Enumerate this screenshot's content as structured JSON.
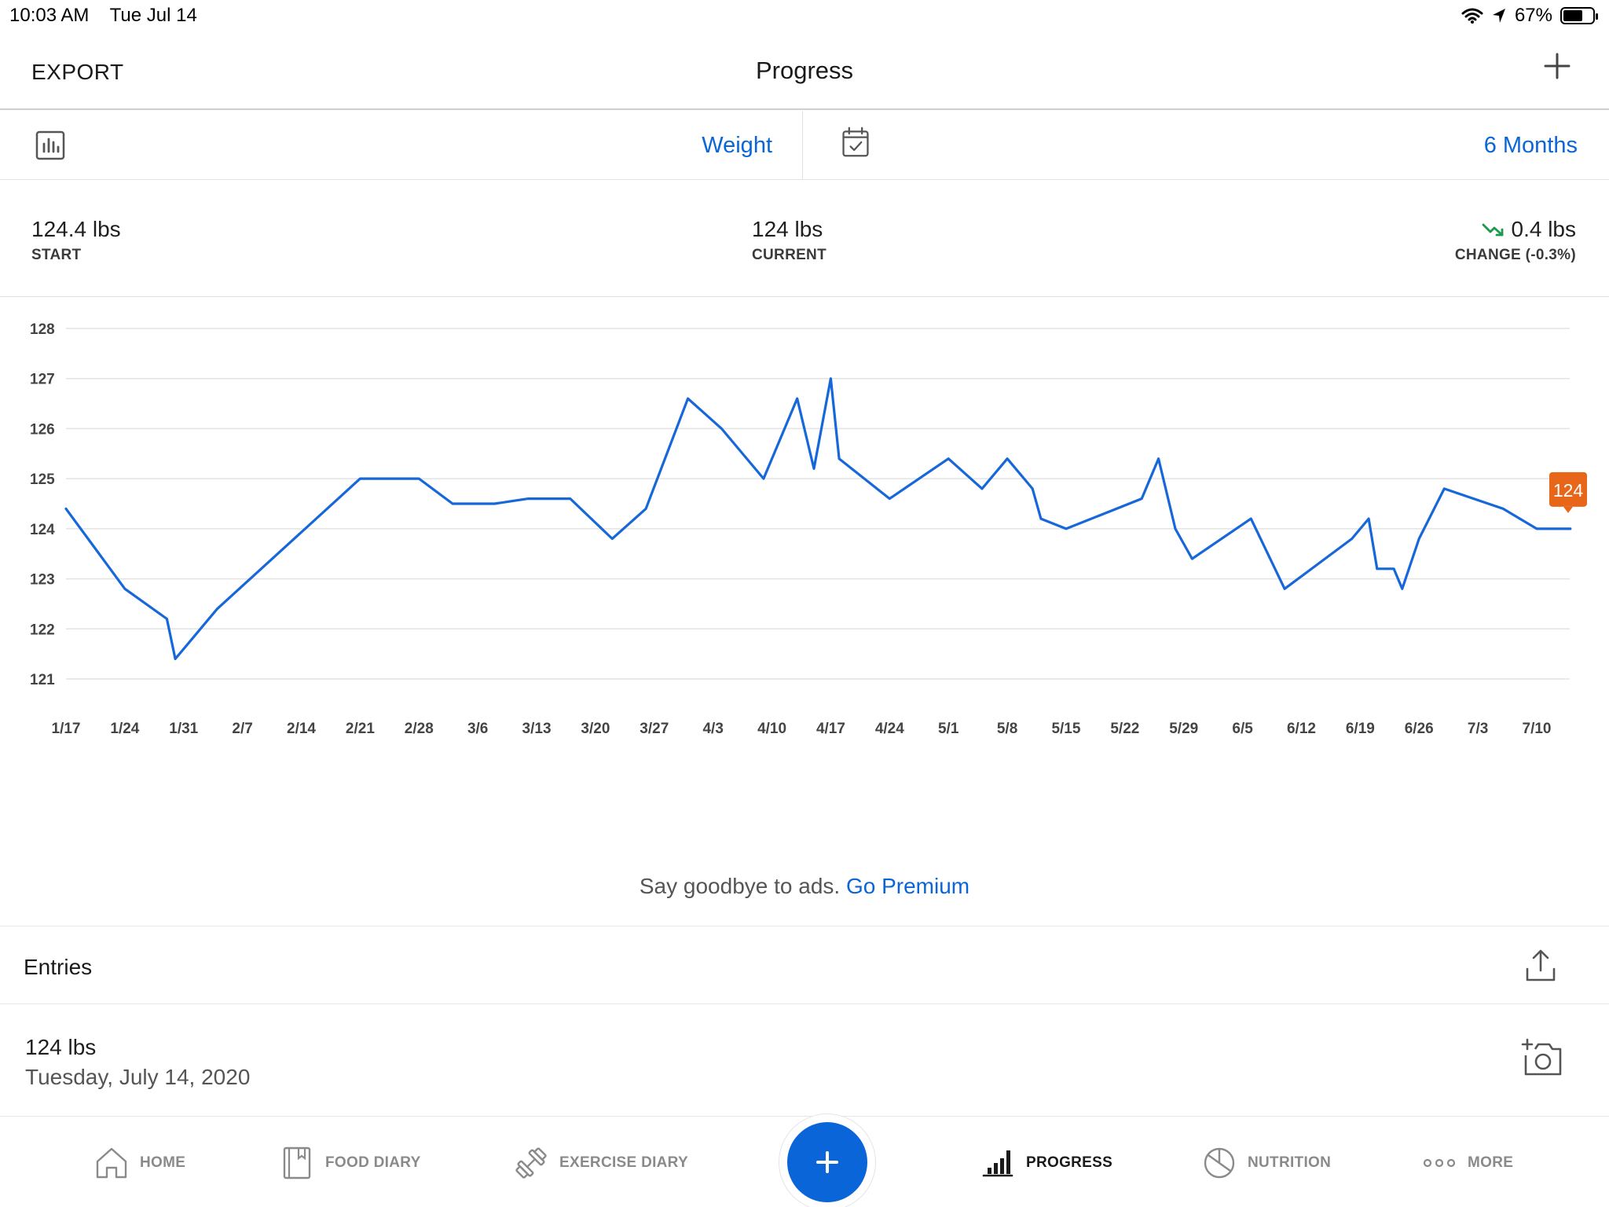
{
  "status": {
    "time": "10:03 AM",
    "date": "Tue Jul 14",
    "battery": "67%",
    "battery_level": 0.67
  },
  "nav": {
    "export_label": "EXPORT",
    "title": "Progress",
    "add_icon": "plus-icon"
  },
  "selectors": {
    "metric_icon": "bar-chart-icon",
    "metric": "Weight",
    "range_icon": "calendar-check-icon",
    "range": "6 Months"
  },
  "summary": {
    "start_value": "124.4 lbs",
    "start_label": "START",
    "current_value": "124 lbs",
    "current_label": "CURRENT",
    "change_value": "0.4 lbs",
    "change_label": "CHANGE (-0.3%)",
    "change_icon": "trend-down-icon"
  },
  "colors": {
    "accent": "#0a66d8",
    "line": "#1667d9",
    "marker": "#e8661a",
    "trend_down": "#1a9a4a"
  },
  "chart_data": {
    "type": "line",
    "ylim": [
      121,
      128
    ],
    "yticks": [
      "128",
      "127",
      "126",
      "125",
      "124",
      "123",
      "122",
      "121"
    ],
    "xticks": [
      "1/17",
      "1/24",
      "1/31",
      "2/7",
      "2/14",
      "2/21",
      "2/28",
      "3/6",
      "3/13",
      "3/20",
      "3/27",
      "4/3",
      "4/10",
      "4/17",
      "4/24",
      "5/1",
      "5/8",
      "5/15",
      "5/22",
      "5/29",
      "6/5",
      "6/12",
      "6/19",
      "6/26",
      "7/3",
      "7/10"
    ],
    "grid": true,
    "x": [
      0,
      7,
      12,
      13,
      18,
      35,
      42,
      45,
      50,
      54,
      59,
      64,
      66,
      73,
      77,
      81,
      85,
      88,
      89,
      93,
      98,
      105,
      110,
      113,
      116,
      119,
      122,
      128,
      134,
      136,
      138,
      142,
      146,
      160,
      161,
      162,
      168,
      174,
      178,
      180,
      181,
      183,
      185,
      188,
      183,
      185,
      187,
      189,
      195,
      198,
      200,
      205,
      213,
      219,
      220,
      227,
      231,
      237,
      240,
      244,
      247,
      255,
      250,
      251,
      255,
      256,
      258,
      262,
      268,
      272,
      275,
      280,
      284,
      290,
      295,
      300,
      301,
      304,
      305,
      307,
      322,
      329,
      335,
      348,
      355,
      361,
      367,
      376,
      387
    ],
    "y_note": "",
    "points": [
      {
        "x": "1/17",
        "y": 124.4
      },
      {
        "x": "1/24",
        "y": 122.8
      },
      {
        "x": "1/29",
        "y": 122.2
      },
      {
        "x": "1/30",
        "y": 121.4
      },
      {
        "x": "2/4",
        "y": 122.4
      },
      {
        "x": "2/21",
        "y": 125.0
      },
      {
        "x": "2/28",
        "y": 125.0
      },
      {
        "x": "3/3",
        "y": 124.5
      },
      {
        "x": "3/8",
        "y": 124.5
      },
      {
        "x": "3/12",
        "y": 124.6
      },
      {
        "x": "3/17",
        "y": 124.6
      },
      {
        "x": "3/22",
        "y": 123.8
      },
      {
        "x": "3/26",
        "y": 124.4
      },
      {
        "x": "3/31",
        "y": 126.6
      },
      {
        "x": "4/4",
        "y": 126.0
      },
      {
        "x": "4/9",
        "y": 125.0
      },
      {
        "x": "4/13",
        "y": 126.6
      },
      {
        "x": "4/15",
        "y": 125.2
      },
      {
        "x": "4/17",
        "y": 127.0
      },
      {
        "x": "4/18",
        "y": 125.4
      },
      {
        "x": "4/24",
        "y": 124.6
      },
      {
        "x": "5/1",
        "y": 125.4
      },
      {
        "x": "5/5",
        "y": 124.8
      },
      {
        "x": "5/8",
        "y": 125.4
      },
      {
        "x": "5/11",
        "y": 124.8
      },
      {
        "x": "5/12",
        "y": 124.2
      },
      {
        "x": "5/15",
        "y": 124.0
      },
      {
        "x": "5/24",
        "y": 124.6
      },
      {
        "x": "5/26",
        "y": 125.4
      },
      {
        "x": "5/28",
        "y": 124.0
      },
      {
        "x": "5/30",
        "y": 123.4
      },
      {
        "x": "6/6",
        "y": 124.2
      },
      {
        "x": "6/10",
        "y": 122.8
      },
      {
        "x": "6/18",
        "y": 123.8
      },
      {
        "x": "6/20",
        "y": 124.2
      },
      {
        "x": "6/21",
        "y": 123.2
      },
      {
        "x": "6/23",
        "y": 123.2
      },
      {
        "x": "6/24",
        "y": 122.8
      },
      {
        "x": "6/26",
        "y": 123.8
      },
      {
        "x": "6/29",
        "y": 124.8
      },
      {
        "x": "7/6",
        "y": 124.4
      },
      {
        "x": "7/10",
        "y": 124.0
      },
      {
        "x": "7/14",
        "y": 124.0
      }
    ],
    "marker_label": "124"
  },
  "promo": {
    "text": "Say goodbye to ads.",
    "link": "Go Premium"
  },
  "entries": {
    "title": "Entries",
    "share_icon": "share-icon",
    "items": [
      {
        "value": "124 lbs",
        "date": "Tuesday, July 14, 2020",
        "icon": "add-photo-icon"
      }
    ]
  },
  "tabs": [
    {
      "label": "HOME",
      "icon": "home-icon"
    },
    {
      "label": "FOOD DIARY",
      "icon": "book-icon"
    },
    {
      "label": "EXERCISE DIARY",
      "icon": "dumbbell-icon"
    },
    {
      "label": "PROGRESS",
      "icon": "bar-chart-icon",
      "active": true
    },
    {
      "label": "NUTRITION",
      "icon": "pie-chart-icon"
    },
    {
      "label": "MORE",
      "icon": "more-dots-icon"
    }
  ],
  "fab_icon": "plus-icon"
}
